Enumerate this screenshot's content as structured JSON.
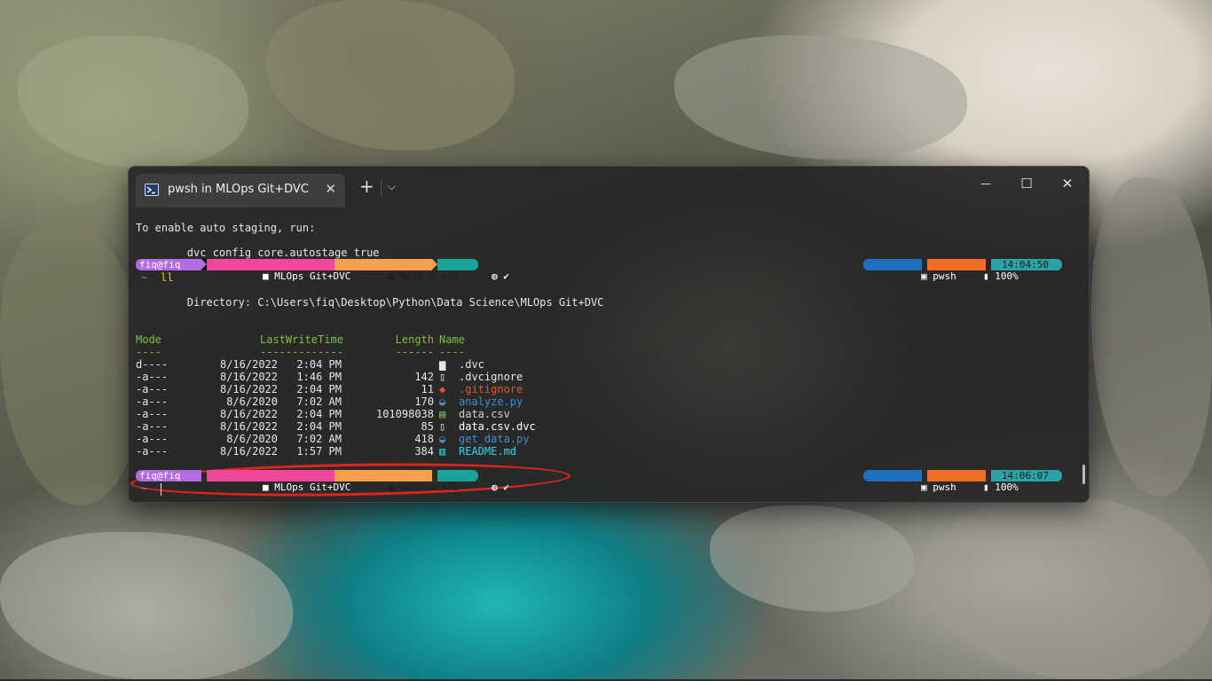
{
  "window": {
    "tab_title": "pwsh in MLOps Git+DVC",
    "tab_close": "✕",
    "new_tab": "+",
    "dropdown": "⌵",
    "minimize": "—",
    "maximize": "☐",
    "close": "✕"
  },
  "terminal": {
    "line1": "To enable auto staging, run:",
    "line2": "        dvc config core.autostage true",
    "prompt1": {
      "user": "fiq@fiq",
      "folder": "MLOps Git+DVC",
      "git": "main ≡ ✎?2",
      "check": "✔",
      "shell": "pwsh",
      "battery": "100%",
      "time": "14:04:50"
    },
    "tilde": "~",
    "command": "ll",
    "directory": "        Directory: C:\\Users\\fiq\\Desktop\\Python\\Data Science\\MLOps Git+DVC",
    "headers": {
      "mode": "Mode",
      "lastwrite": "LastWriteTime",
      "length": "Length",
      "name": "Name"
    },
    "underlines": {
      "mode": "----",
      "lastwrite": "-------------",
      "length": "------",
      "name": "----"
    },
    "files": [
      {
        "mode": "d----",
        "date": "8/16/2022",
        "time": "2:04 PM",
        "length": "",
        "name": ".dvc",
        "color": "#e6e6e6",
        "icon": "folder-icon",
        "icon_color": "#e6e6e6"
      },
      {
        "mode": "-a---",
        "date": "8/16/2022",
        "time": "1:46 PM",
        "length": "142",
        "name": ".dvcignore",
        "color": "#e6e6e6",
        "icon": "file-icon",
        "icon_color": "#e6e6e6"
      },
      {
        "mode": "-a---",
        "date": "8/16/2022",
        "time": "2:04 PM",
        "length": "11",
        "name": ".gitignore",
        "color": "#e8552a",
        "icon": "git-icon",
        "icon_color": "#e8552a"
      },
      {
        "mode": "-a---",
        "date": "8/6/2020",
        "time": "7:02 AM",
        "length": "170",
        "name": "analyze.py",
        "color": "#3f8ed0",
        "icon": "python-icon",
        "icon_color": "#3f8ed0"
      },
      {
        "mode": "-a---",
        "date": "8/16/2022",
        "time": "2:04 PM",
        "length": "101098038",
        "name": "data.csv",
        "color": "#cfcfcf",
        "icon": "csv-icon",
        "icon_color": "#7fbf3f"
      },
      {
        "mode": "-a---",
        "date": "8/16/2022",
        "time": "2:04 PM",
        "length": "85",
        "name": "data.csv.dvc",
        "color": "#ffffff",
        "icon": "file-icon",
        "icon_color": "#e6e6e6"
      },
      {
        "mode": "-a---",
        "date": "8/6/2020",
        "time": "7:02 AM",
        "length": "418",
        "name": "get_data.py",
        "color": "#3f8ed0",
        "icon": "python-icon",
        "icon_color": "#3f8ed0"
      },
      {
        "mode": "-a---",
        "date": "8/16/2022",
        "time": "1:57 PM",
        "length": "384",
        "name": "README.md",
        "color": "#2fd4e6",
        "icon": "markdown-icon",
        "icon_color": "#2fd4e6"
      }
    ],
    "prompt2": {
      "user": "fiq@fiq",
      "folder": "MLOps Git+DVC",
      "git": "main ≡ ✎?2",
      "check": "✔",
      "shell": "pwsh",
      "battery": "100%",
      "time": "14:06:07"
    }
  },
  "colors": {
    "user_segment": "#b26be0",
    "folder_segment": "#f0479b",
    "git_segment": "#f6a04d",
    "status_segment": "#1aa39a",
    "shell_segment": "#1f6fbf",
    "battery_segment": "#f26d22",
    "time_segment": "#2aa3a6",
    "header_green": "#7fbf3f",
    "annotation_red": "#e0241b"
  }
}
